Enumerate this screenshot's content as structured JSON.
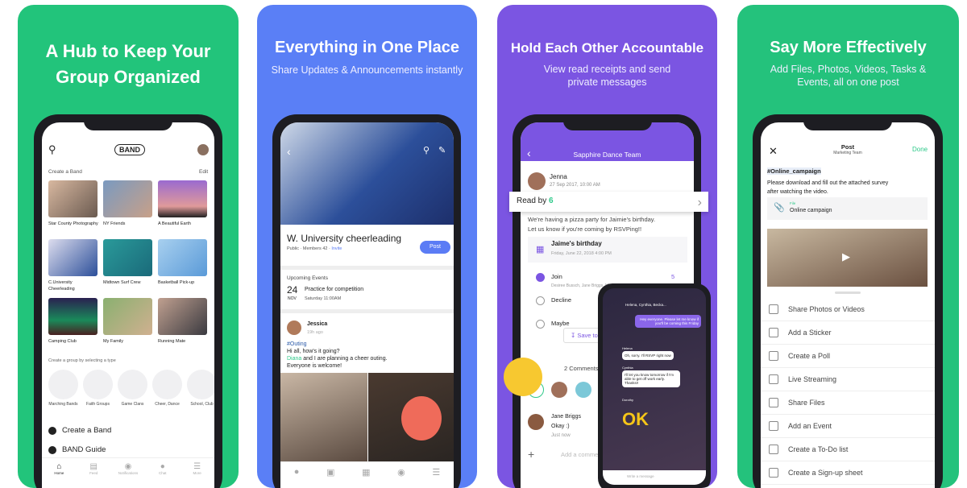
{
  "colors": {
    "panel1": "#22c47b",
    "panel2": "#5a7ff6",
    "panel3": "#7b55e2",
    "panel4": "#24c27c",
    "accent_green": "#2fc98a",
    "accent_purple": "#7b55e2",
    "post_button": "#5b7cf5"
  },
  "panel1": {
    "headline": "A Hub to Keep Your Group Organized",
    "app": {
      "logo": "BAND",
      "create_band": "Create a Band",
      "edit": "Edit",
      "bands": [
        {
          "name": "Star County Photography"
        },
        {
          "name": "NY Friends"
        },
        {
          "name": "A Beautiful Earth"
        },
        {
          "name": "C.University Cheerleading"
        },
        {
          "name": "Midtown Surf Crew"
        },
        {
          "name": "Basketball Pick-up"
        },
        {
          "name": "Camping Club"
        },
        {
          "name": "My Family"
        },
        {
          "name": "Running Mate"
        }
      ],
      "type_prompt": "Create a group by selecting a type",
      "types": [
        {
          "label": "Marching Bands",
          "icon": "drum-icon"
        },
        {
          "label": "Faith Groups",
          "icon": "book-icon"
        },
        {
          "label": "Game Clans",
          "icon": "gamepad-icon"
        },
        {
          "label": "Cheer, Dance",
          "icon": "dancer-icon"
        },
        {
          "label": "School, Club",
          "icon": "jersey-icon"
        }
      ],
      "create_band_link": "Create a Band",
      "guide_link": "BAND Guide",
      "tabs": [
        "Home",
        "Feed",
        "Notifications",
        "Chat",
        "More"
      ]
    }
  },
  "panel2": {
    "headline": "Everything in One Place",
    "subtitle": "Share Updates & Announcements instantly",
    "app": {
      "band_name": "W. University cheerleading",
      "meta_public": "Public",
      "meta_members": "Members 42",
      "invite": "Invite",
      "post_button": "Post",
      "events_title": "Upcoming Events",
      "event_day": "24",
      "event_month": "NOV",
      "event_title": "Practice for competition",
      "event_time": "Saturday 11:00AM",
      "author": "Jessica",
      "time_ago": "19h ago",
      "hashtag": "#Outing",
      "line1": "Hi all, how's it going?",
      "mention": "Diana",
      "line2": " and I are planning a cheer outing.",
      "line3": "Everyone is welcome!"
    }
  },
  "panel3": {
    "headline": "Hold Each Other Accountable",
    "subtitle": "View read receipts and send private messages",
    "app": {
      "band_name": "Sapphire Dance Team",
      "author": "Jenna",
      "date": "27 Sep 2017, 10:00 AM",
      "read_by_label": "Read by",
      "read_by_count": "6",
      "post_text1": "We're having a pizza party for Jaimie's birthday.",
      "post_text2": "Let us know if you're coming by RSVPing!!",
      "event_title": "Jaime's birthday",
      "event_date": "Friday, June 22, 2018 4:00 PM",
      "rsvp": [
        {
          "label": "Join",
          "checked": true,
          "count": "5",
          "names": "Desiree Bussch, Jane Briggs, Michelle, Kent, Ken"
        },
        {
          "label": "Decline",
          "checked": false
        },
        {
          "label": "Maybe",
          "checked": false
        }
      ],
      "save_label": "Save to",
      "comments": "2 Comments",
      "commenter": "Jane Briggs",
      "comment": "Okay :)",
      "comment_time": "Just now",
      "comment_placeholder": "Add a comment",
      "chat": {
        "title": "Helena, Cynthia, Becka...",
        "msg_me": "Hey everyone. Please let me know if you'll be coming this Friday",
        "helena": "Helena",
        "msg_helena": "Oh, sorry. I'll RSVP right now",
        "cynthia": "Cynthia",
        "msg_cynthia": "I'll let you know tomorrow if I'm able to get off work early. Thanks!!",
        "dorothy": "Dorothy",
        "sticker": "OK",
        "placeholder": "Write a message"
      }
    }
  },
  "panel4": {
    "headline": "Say More Effectively",
    "subtitle": "Add Files, Photos, Videos, Tasks & Events, all on one post",
    "app": {
      "title": "Post",
      "subtitle": "Marketing Team",
      "done": "Done",
      "hashtag": "#Online_campaign",
      "body": "Please download and fill out the attached survey after watching the video.",
      "file_label": "File",
      "file_name": "Online campaign",
      "menu": [
        {
          "label": "Share Photos or Videos",
          "icon": "photo-icon"
        },
        {
          "label": "Add a Sticker",
          "icon": "sticker-icon"
        },
        {
          "label": "Create a Poll",
          "icon": "poll-icon"
        },
        {
          "label": "Live Streaming",
          "icon": "live-icon"
        },
        {
          "label": "Share Files",
          "icon": "paperclip-icon"
        },
        {
          "label": "Add an Event",
          "icon": "calendar-icon"
        },
        {
          "label": "Create a To-Do list",
          "icon": "todo-icon"
        },
        {
          "label": "Create a Sign-up sheet",
          "icon": "signup-icon"
        }
      ]
    }
  }
}
